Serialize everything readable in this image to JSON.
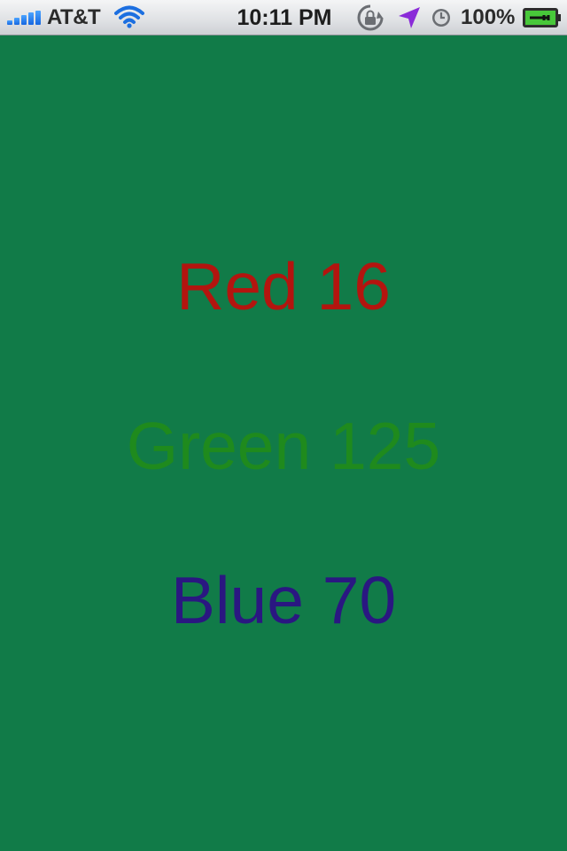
{
  "status_bar": {
    "carrier": "AT&T",
    "time": "10:11 PM",
    "battery_percent": "100%",
    "signal_bars": 5,
    "icons": [
      "signal-icon",
      "wifi-icon",
      "rotation-lock-icon",
      "location-icon",
      "alarm-icon",
      "battery-charging-icon"
    ]
  },
  "background_color": "#117b48",
  "labels": {
    "red": "Red 16",
    "green": "Green 125",
    "blue": "Blue 70"
  },
  "label_colors": {
    "red": "#b3150f",
    "green": "#1f8a1d",
    "blue": "#2a1781"
  }
}
